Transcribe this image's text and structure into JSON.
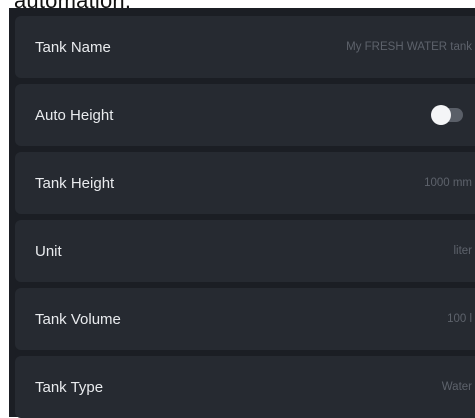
{
  "caption": "automation.",
  "settings": {
    "tank_name": {
      "label": "Tank Name",
      "value": "My FRESH WATER tank"
    },
    "auto_height": {
      "label": "Auto Height",
      "enabled": false
    },
    "tank_height": {
      "label": "Tank Height",
      "value": "1000 mm"
    },
    "unit": {
      "label": "Unit",
      "value": "liter"
    },
    "tank_volume": {
      "label": "Tank Volume",
      "value": "100 l"
    },
    "tank_type": {
      "label": "Tank Type",
      "value": "Water"
    }
  },
  "colors": {
    "panel_bg": "#1b1e24",
    "row_bg": "#262a31",
    "label_text": "#e9ebee",
    "value_text": "#5d626b",
    "toggle_track": "#5a5f68",
    "toggle_knob": "#f4f5f7"
  }
}
